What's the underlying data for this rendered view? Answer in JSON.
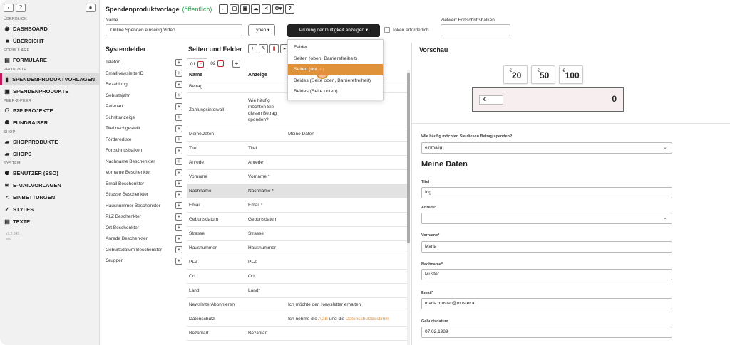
{
  "sidebar": {
    "sections": {
      "ueberblick": "ÜBERBLICK",
      "formulare": "FORMULARE",
      "produkte": "PRODUKTE",
      "peer": "PEER-2-PEER",
      "shop": "SHOP",
      "system": "SYSTEM"
    },
    "items": {
      "dashboard": "DASHBOARD",
      "uebersicht": "ÜBERSICHT",
      "formulare": "FORMULARE",
      "spendenproduktvorlagen": "SPENDENPRODUKTVORLAGEN",
      "spendenprodukte": "SPENDENPRODUKTE",
      "p2p": "P2P PROJEKTE",
      "fundraiser": "FUNDRAISER",
      "shopprodukte": "SHOPPRODUKTE",
      "shops": "SHOPS",
      "benutzer": "BENUTZER (SSO)",
      "emailvorlagen": "E-MAILVORLAGEN",
      "einbettungen": "EINBETTUNGEN",
      "styles": "STYLES",
      "texte": "TEXTE"
    },
    "version": "v1.2.345",
    "env": "test"
  },
  "header": {
    "title": "Spendenproduktvorlage",
    "status": "(öffentlich)",
    "name_label": "Name",
    "name_value": "Online Spenden einseitig Video",
    "typen_label": "Typen",
    "pruefung_label": "Prüfung der Gültigkeit anzeigen",
    "token_label": "Token erforderlich",
    "ziel_label": "Zielwert Fortschrittsbalken"
  },
  "dropdown": {
    "items": [
      "Felder",
      "Seiten (oben, Barrierefreiheit)",
      "Seiten (unten)",
      "Beides (Seite oben, Barrierefreiheit)",
      "Beides (Seite unten)"
    ]
  },
  "systemfelder": {
    "title": "Systemfelder",
    "items": [
      "Telefon",
      "EmailNewsletterID",
      "Bezahlung",
      "Geburtsjahr",
      "Patenart",
      "Schrittanzeige",
      "Titel nachgestellt",
      "Fördererliste",
      "Fortschrittsbalken",
      "Nachname Beschenkter",
      "Vorname Beschenkter",
      "Email Beschenkter",
      "Strasse Beschenkter",
      "Hausnummer Beschenkter",
      "PLZ Beschenkter",
      "Ort Beschenkter",
      "Anrede Beschenkter",
      "Geburtsdatum Beschenkter",
      "Gruppen"
    ]
  },
  "seiten": {
    "title": "Seiten und Felder",
    "tab1": "01",
    "tab2": "02",
    "col_name": "Name",
    "col_anzeige": "Anzeige",
    "rows": [
      {
        "name": "Betrag",
        "anzeige": "",
        "extra": ""
      },
      {
        "name": "Zahlungsintervall",
        "anzeige": "Wie häufig möchten Sie diesen Betrag spenden?",
        "extra": ""
      },
      {
        "name": "MeineDaten",
        "anzeige": "",
        "extra": "Meine Daten"
      },
      {
        "name": "Titel",
        "anzeige": "Titel",
        "extra": ""
      },
      {
        "name": "Anrede",
        "anzeige": "Anrede*",
        "extra": ""
      },
      {
        "name": "Vorname",
        "anzeige": "Vorname *",
        "extra": ""
      },
      {
        "name": "Nachname",
        "anzeige": "Nachname *",
        "extra": ""
      },
      {
        "name": "Email",
        "anzeige": "Email *",
        "extra": ""
      },
      {
        "name": "Geburtsdatum",
        "anzeige": "Geburtsdatum",
        "extra": ""
      },
      {
        "name": "Strasse",
        "anzeige": "Strasse",
        "extra": ""
      },
      {
        "name": "Hausnummer",
        "anzeige": "Hausnummer",
        "extra": ""
      },
      {
        "name": "PLZ",
        "anzeige": "PLZ",
        "extra": ""
      },
      {
        "name": "Ort",
        "anzeige": "Ort",
        "extra": ""
      },
      {
        "name": "Land",
        "anzeige": "Land*",
        "extra": ""
      },
      {
        "name": "NewsletterAbonnieren",
        "anzeige": "",
        "extra": "Ich möchte den Newsletter erhalten"
      },
      {
        "name": "Datenschutz",
        "anzeige": "",
        "extra": "Ich nehme die ",
        "link1": "AGB",
        "mid": " und die ",
        "link2": "Datenschutzbestimm"
      },
      {
        "name": "Bezahlart",
        "anzeige": "Bezahlart",
        "extra": ""
      }
    ]
  },
  "vorschau": {
    "title": "Vorschau",
    "currency": "€",
    "amounts": [
      "20",
      "50",
      "100"
    ],
    "custom_value": "0",
    "q_label": "Wie häufig möchten Sie diesen Betrag spenden?",
    "q_value": "einmalig",
    "meine_daten": "Meine Daten",
    "titel_label": "Titel",
    "titel_value": "Ing.",
    "anrede_label": "Anrede*",
    "anrede_value": "",
    "vorname_label": "Vorname*",
    "vorname_value": "Maria",
    "nachname_label": "Nachname*",
    "nachname_value": "Muster",
    "email_label": "Email*",
    "email_value": "maria.muster@muster.at",
    "geb_label": "Geburtsdatum",
    "geb_value": "07.02.1989"
  },
  "colors": {
    "accent": "#c2185b",
    "highlight": "#e0923a",
    "public": "#2e9e4f"
  }
}
